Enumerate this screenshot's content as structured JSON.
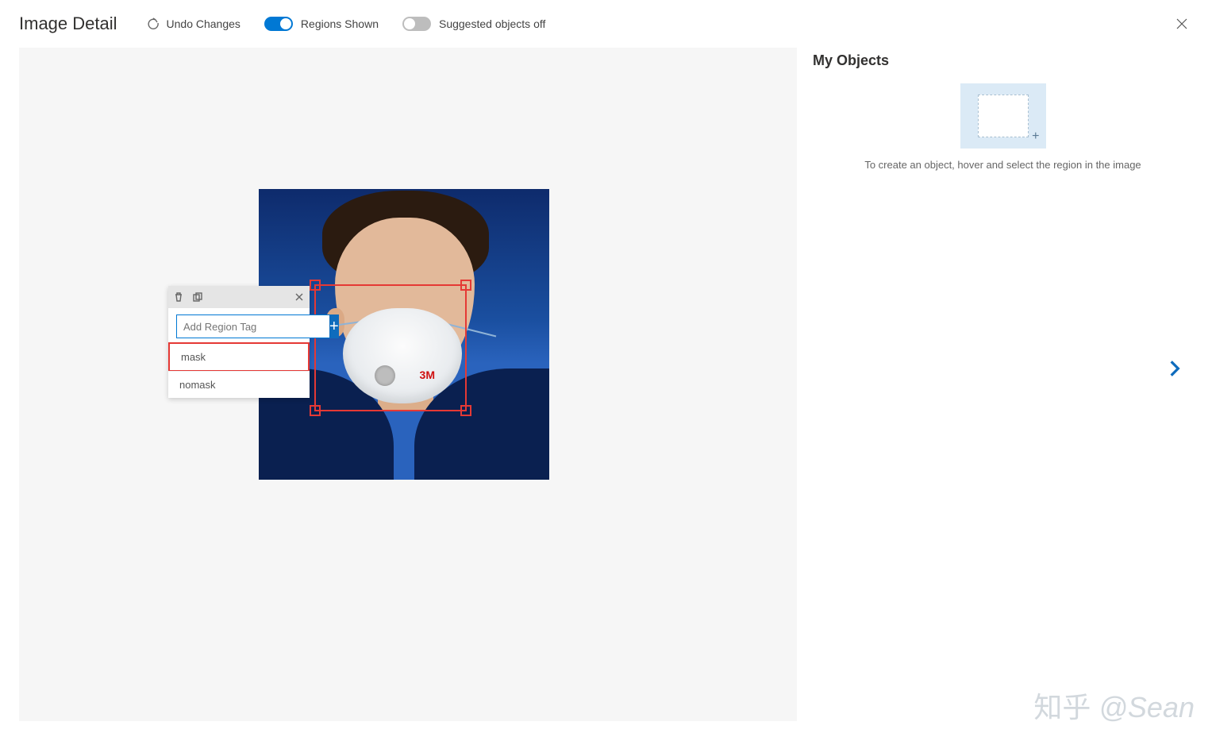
{
  "header": {
    "title": "Image Detail",
    "undo_label": "Undo Changes",
    "regions_label": "Regions Shown",
    "regions_on": true,
    "suggested_label": "Suggested objects off",
    "suggested_on": false
  },
  "sidebar": {
    "title": "My Objects",
    "help_text": "To create an object, hover and select the region in the image"
  },
  "tag_popup": {
    "placeholder": "Add Region Tag",
    "options": [
      "mask",
      "nomask"
    ],
    "selected_index": 0
  },
  "image": {
    "mask_brand": "3M"
  },
  "watermark": {
    "site": "知乎",
    "author": "@Sean"
  }
}
